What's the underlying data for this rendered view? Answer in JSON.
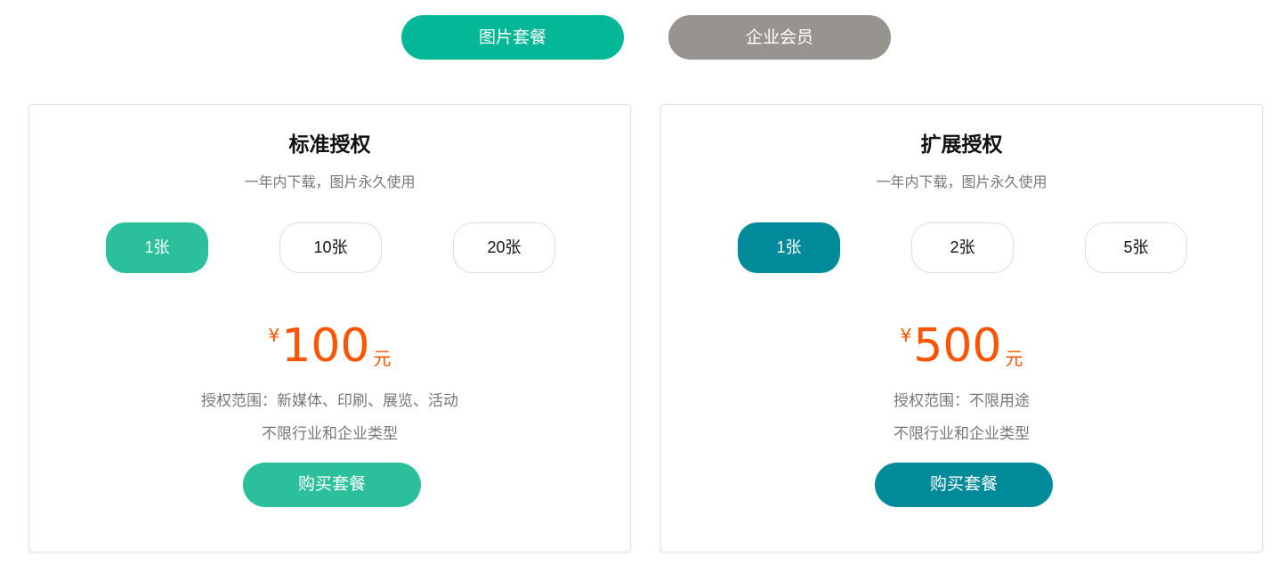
{
  "colors": {
    "tab_active": "#04b797",
    "tab_inactive": "#97938f",
    "green": "#2bbf9c",
    "teal": "#018b9a",
    "price_orange": "#fd5400",
    "muted_text": "#777777"
  },
  "tabs": [
    {
      "label": "图片套餐",
      "active": true
    },
    {
      "label": "企业会员",
      "active": false
    }
  ],
  "cards": [
    {
      "title": "标准授权",
      "subtitle": "一年内下载，图片永久使用",
      "quantities": [
        "1张",
        "10张",
        "20张"
      ],
      "selected_index": 0,
      "price": {
        "symbol": "¥",
        "amount": "100",
        "unit": "元"
      },
      "scope": "授权范围：新媒体、印刷、展览、活动",
      "industry": "不限行业和企业类型",
      "buy_label": "购买套餐"
    },
    {
      "title": "扩展授权",
      "subtitle": "一年内下载，图片永久使用",
      "quantities": [
        "1张",
        "2张",
        "5张"
      ],
      "selected_index": 0,
      "price": {
        "symbol": "¥",
        "amount": "500",
        "unit": "元"
      },
      "scope": "授权范围：不限用途",
      "industry": "不限行业和企业类型",
      "buy_label": "购买套餐"
    }
  ]
}
